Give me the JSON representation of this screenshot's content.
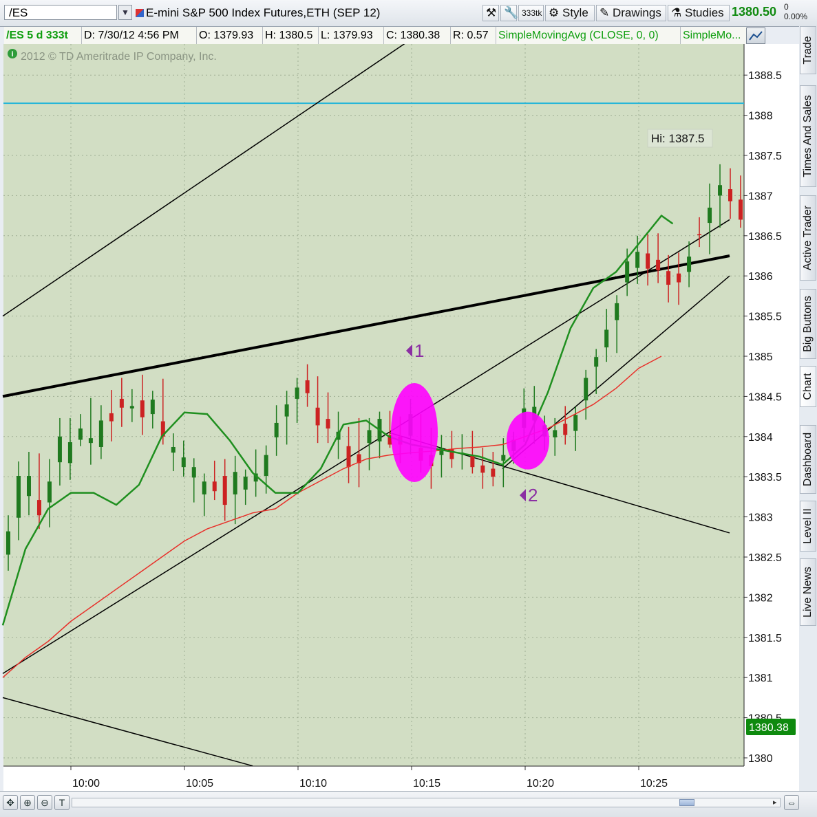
{
  "toolbar": {
    "symbol": "/ES",
    "title": "E-mini S&P 500 Index Futures,ETH (SEP 12)",
    "aggregation": "333tk",
    "style_label": "Style",
    "drawings_label": "Drawings",
    "studies_label": "Studies",
    "last_price": "1380.50",
    "change": "0",
    "change_pct": "0.00%"
  },
  "infobar": {
    "symbol": "/ES 5 d 333t",
    "date": "D: 7/30/12 4:56 PM",
    "open": "O: 1379.93",
    "high": "H: 1380.5",
    "low": "L: 1379.93",
    "close": "C: 1380.38",
    "range": "R: 0.57",
    "study1": "SimpleMovingAvg (CLOSE, 0, 0)",
    "study2": "SimpleMo..."
  },
  "sidebar": {
    "tabs": [
      "Trade",
      "Times And Sales",
      "Active Trader",
      "Big Buttons",
      "Chart",
      "Dashboard",
      "Level II",
      "Live News"
    ]
  },
  "chart_data": {
    "type": "candlestick",
    "watermark": "2012 © TD Ameritrade IP Company, Inc.",
    "y_ticks": [
      "1388.5",
      "1388",
      "1387.5",
      "1387",
      "1386.5",
      "1386",
      "1385.5",
      "1385",
      "1384.5",
      "1384",
      "1383.5",
      "1383",
      "1382.5",
      "1382",
      "1381.5",
      "1381",
      "1380.5",
      "1380"
    ],
    "x_ticks": [
      "10:00",
      "10:05",
      "10:10",
      "10:15",
      "10:20",
      "10:25"
    ],
    "ylim": [
      1379.9,
      1389.1
    ],
    "high_label": "Hi: 1387.5",
    "price_label": "1380.38",
    "horizontal_line": 1388.15,
    "colors": {
      "up": "#1f7a1f",
      "down": "#cc2222",
      "sma_fast": "#1f8f1f",
      "sma_slow": "#e8302a",
      "horizontal": "#27b6d8",
      "highlight": "#ff00ff",
      "marker": "#8b2fa3",
      "price_box": "#0e8a0e"
    },
    "annotations": [
      {
        "label": "1",
        "time": "10:15",
        "price": 1385.07
      },
      {
        "label": "2",
        "time": "10:20",
        "price": 1383.27
      }
    ],
    "highlights": [
      {
        "time": "10:15",
        "price": 1384.05
      },
      {
        "time": "10:20",
        "price": 1383.95
      }
    ],
    "trendlines": [
      {
        "from": [
          "09:57",
          1385.5
        ],
        "to": [
          "10:15",
          1388.95
        ],
        "width": 1.5
      },
      {
        "from": [
          "09:57",
          1384.5
        ],
        "to": [
          "10:29",
          1386.25
        ],
        "width": 4
      },
      {
        "from": [
          "09:57",
          1381.05
        ],
        "to": [
          "10:29",
          1386.7
        ],
        "width": 1.5
      },
      {
        "from": [
          "10:14",
          1384.05
        ],
        "to": [
          "10:29",
          1382.8
        ],
        "width": 1.5
      },
      {
        "from": [
          "10:19",
          1383.6
        ],
        "to": [
          "10:29",
          1386.0
        ],
        "width": 1.5
      },
      {
        "from": [
          "09:57",
          1380.75
        ],
        "to": [
          "10:08",
          1379.9
        ],
        "width": 1.5
      }
    ],
    "series": [
      {
        "name": "SimpleMovingAvg",
        "points": [
          [
            "09:57",
            1381.65
          ],
          [
            "09:58",
            1382.6
          ],
          [
            "09:59",
            1383.1
          ],
          [
            "10:00",
            1383.3
          ],
          [
            "10:01",
            1383.3
          ],
          [
            "10:02",
            1383.15
          ],
          [
            "10:03",
            1383.4
          ],
          [
            "10:04",
            1384.0
          ],
          [
            "10:05",
            1384.3
          ],
          [
            "10:06",
            1384.28
          ],
          [
            "10:07",
            1383.95
          ],
          [
            "10:08",
            1383.55
          ],
          [
            "10:09",
            1383.3
          ],
          [
            "10:10",
            1383.3
          ],
          [
            "10:11",
            1383.6
          ],
          [
            "10:12",
            1384.15
          ],
          [
            "10:13",
            1384.2
          ],
          [
            "10:14",
            1384.0
          ],
          [
            "10:15",
            1383.9
          ],
          [
            "10:16",
            1383.85
          ],
          [
            "10:17",
            1383.8
          ],
          [
            "10:18",
            1383.75
          ],
          [
            "10:19",
            1383.65
          ],
          [
            "10:20",
            1383.9
          ],
          [
            "10:21",
            1384.55
          ],
          [
            "10:22",
            1385.35
          ],
          [
            "10:23",
            1385.85
          ],
          [
            "10:24",
            1386.05
          ],
          [
            "10:25",
            1386.4
          ],
          [
            "10:26",
            1386.75
          ],
          [
            "10:26:30",
            1386.65
          ]
        ]
      },
      {
        "name": "SimpleMovingAvg",
        "points": [
          [
            "09:57",
            1381.0
          ],
          [
            "09:58",
            1381.25
          ],
          [
            "09:59",
            1381.45
          ],
          [
            "10:00",
            1381.7
          ],
          [
            "10:01",
            1381.9
          ],
          [
            "10:02",
            1382.1
          ],
          [
            "10:03",
            1382.3
          ],
          [
            "10:04",
            1382.5
          ],
          [
            "10:05",
            1382.7
          ],
          [
            "10:06",
            1382.85
          ],
          [
            "10:07",
            1382.95
          ],
          [
            "10:08",
            1383.05
          ],
          [
            "10:09",
            1383.1
          ],
          [
            "10:10",
            1383.3
          ],
          [
            "10:11",
            1383.45
          ],
          [
            "10:12",
            1383.6
          ],
          [
            "10:13",
            1383.72
          ],
          [
            "10:14",
            1383.77
          ],
          [
            "10:15",
            1383.8
          ],
          [
            "10:16",
            1383.82
          ],
          [
            "10:17",
            1383.85
          ],
          [
            "10:18",
            1383.87
          ],
          [
            "10:19",
            1383.9
          ],
          [
            "10:20",
            1384.0
          ],
          [
            "10:21",
            1384.1
          ],
          [
            "10:22",
            1384.25
          ],
          [
            "10:23",
            1384.4
          ],
          [
            "10:24",
            1384.6
          ],
          [
            "10:25",
            1384.85
          ],
          [
            "10:26",
            1385.0
          ]
        ]
      }
    ],
    "candles": [
      [
        1382.53,
        1383.02,
        1382.33,
        1382.82
      ],
      [
        1382.99,
        1383.69,
        1382.71,
        1383.51
      ],
      [
        1383.26,
        1383.81,
        1383.02,
        1383.51
      ],
      [
        1383.21,
        1383.79,
        1382.85,
        1383.02
      ],
      [
        1383.18,
        1383.72,
        1382.87,
        1383.44
      ],
      [
        1383.68,
        1384.23,
        1383.39,
        1384.0
      ],
      [
        1383.67,
        1384.23,
        1383.46,
        1383.93
      ],
      [
        1383.96,
        1384.28,
        1383.88,
        1384.1
      ],
      [
        1383.92,
        1384.48,
        1383.65,
        1383.98
      ],
      [
        1383.87,
        1384.39,
        1383.72,
        1384.2
      ],
      [
        1384.29,
        1384.58,
        1383.94,
        1384.19
      ],
      [
        1384.47,
        1384.73,
        1384.12,
        1384.36
      ],
      [
        1384.35,
        1384.59,
        1384.18,
        1384.38
      ],
      [
        1384.45,
        1384.77,
        1384.02,
        1384.24
      ],
      [
        1384.28,
        1384.57,
        1384.1,
        1384.46
      ],
      [
        1384.19,
        1384.72,
        1383.9,
        1384.0
      ],
      [
        1383.8,
        1384.04,
        1383.57,
        1383.87
      ],
      [
        1383.62,
        1383.95,
        1383.5,
        1383.74
      ],
      [
        1383.49,
        1383.73,
        1383.18,
        1383.62
      ],
      [
        1383.28,
        1383.54,
        1383.01,
        1383.44
      ],
      [
        1383.44,
        1383.7,
        1383.21,
        1383.32
      ],
      [
        1383.51,
        1383.72,
        1382.95,
        1383.15
      ],
      [
        1383.28,
        1383.76,
        1382.91,
        1383.56
      ],
      [
        1383.34,
        1383.59,
        1383.15,
        1383.5
      ],
      [
        1383.44,
        1383.84,
        1383.25,
        1383.54
      ],
      [
        1383.51,
        1383.89,
        1383.29,
        1383.77
      ],
      [
        1383.99,
        1384.39,
        1383.76,
        1384.17
      ],
      [
        1384.25,
        1384.57,
        1383.9,
        1384.4
      ],
      [
        1384.47,
        1384.73,
        1384.17,
        1384.61
      ],
      [
        1384.7,
        1384.9,
        1384.37,
        1384.54
      ],
      [
        1384.36,
        1384.75,
        1383.92,
        1384.14
      ],
      [
        1384.22,
        1384.55,
        1383.92,
        1384.1
      ],
      [
        1383.96,
        1384.31,
        1383.72,
        1384.06
      ],
      [
        1383.88,
        1384.12,
        1383.42,
        1383.62
      ],
      [
        1383.78,
        1384.23,
        1383.37,
        1383.67
      ],
      [
        1383.92,
        1384.23,
        1383.58,
        1384.08
      ],
      [
        1383.94,
        1384.31,
        1383.73,
        1384.22
      ],
      [
        1384.02,
        1384.32,
        1383.86,
        1383.9
      ],
      [
        1384.0,
        1384.25,
        1383.67,
        1383.9
      ],
      [
        1384.01,
        1384.47,
        1383.78,
        1384.28
      ],
      [
        1383.86,
        1384.28,
        1383.55,
        1383.7
      ],
      [
        1383.77,
        1384.11,
        1383.35,
        1383.63
      ],
      [
        1383.77,
        1384.02,
        1383.49,
        1383.86
      ],
      [
        1383.84,
        1384.07,
        1383.61,
        1383.72
      ],
      [
        1383.8,
        1384.03,
        1383.59,
        1383.8
      ],
      [
        1383.76,
        1384.07,
        1383.54,
        1383.62
      ],
      [
        1383.64,
        1383.86,
        1383.35,
        1383.55
      ],
      [
        1383.6,
        1383.81,
        1383.38,
        1383.5
      ],
      [
        1383.7,
        1383.98,
        1383.37,
        1383.77
      ],
      [
        1383.82,
        1384.06,
        1383.66,
        1383.96
      ],
      [
        1384.11,
        1384.6,
        1383.93,
        1384.35
      ],
      [
        1384.2,
        1384.63,
        1383.91,
        1384.37
      ],
      [
        1384.0,
        1384.26,
        1383.83,
        1384.14
      ],
      [
        1383.99,
        1384.23,
        1383.76,
        1384.08
      ],
      [
        1384.16,
        1384.38,
        1383.9,
        1384.02
      ],
      [
        1384.07,
        1384.37,
        1383.82,
        1384.27
      ],
      [
        1384.45,
        1384.83,
        1384.21,
        1384.73
      ],
      [
        1384.87,
        1385.09,
        1384.53,
        1384.99
      ],
      [
        1385.11,
        1385.59,
        1384.93,
        1385.33
      ],
      [
        1385.45,
        1385.76,
        1385.04,
        1385.66
      ],
      [
        1385.92,
        1386.34,
        1385.75,
        1386.18
      ],
      [
        1386.1,
        1386.5,
        1385.9,
        1386.3
      ],
      [
        1386.28,
        1386.52,
        1385.88,
        1386.09
      ],
      [
        1386.2,
        1386.53,
        1385.91,
        1386.07
      ],
      [
        1386.06,
        1386.26,
        1385.67,
        1385.89
      ],
      [
        1386.03,
        1386.29,
        1385.64,
        1385.92
      ],
      [
        1386.05,
        1386.43,
        1385.86,
        1386.24
      ],
      [
        1386.52,
        1386.73,
        1386.36,
        1386.51
      ],
      [
        1386.66,
        1387.15,
        1386.27,
        1386.85
      ],
      [
        1387.0,
        1387.39,
        1386.6,
        1387.13
      ],
      [
        1387.08,
        1387.34,
        1386.71,
        1386.93
      ],
      [
        1386.95,
        1387.25,
        1386.6,
        1386.7
      ]
    ]
  }
}
